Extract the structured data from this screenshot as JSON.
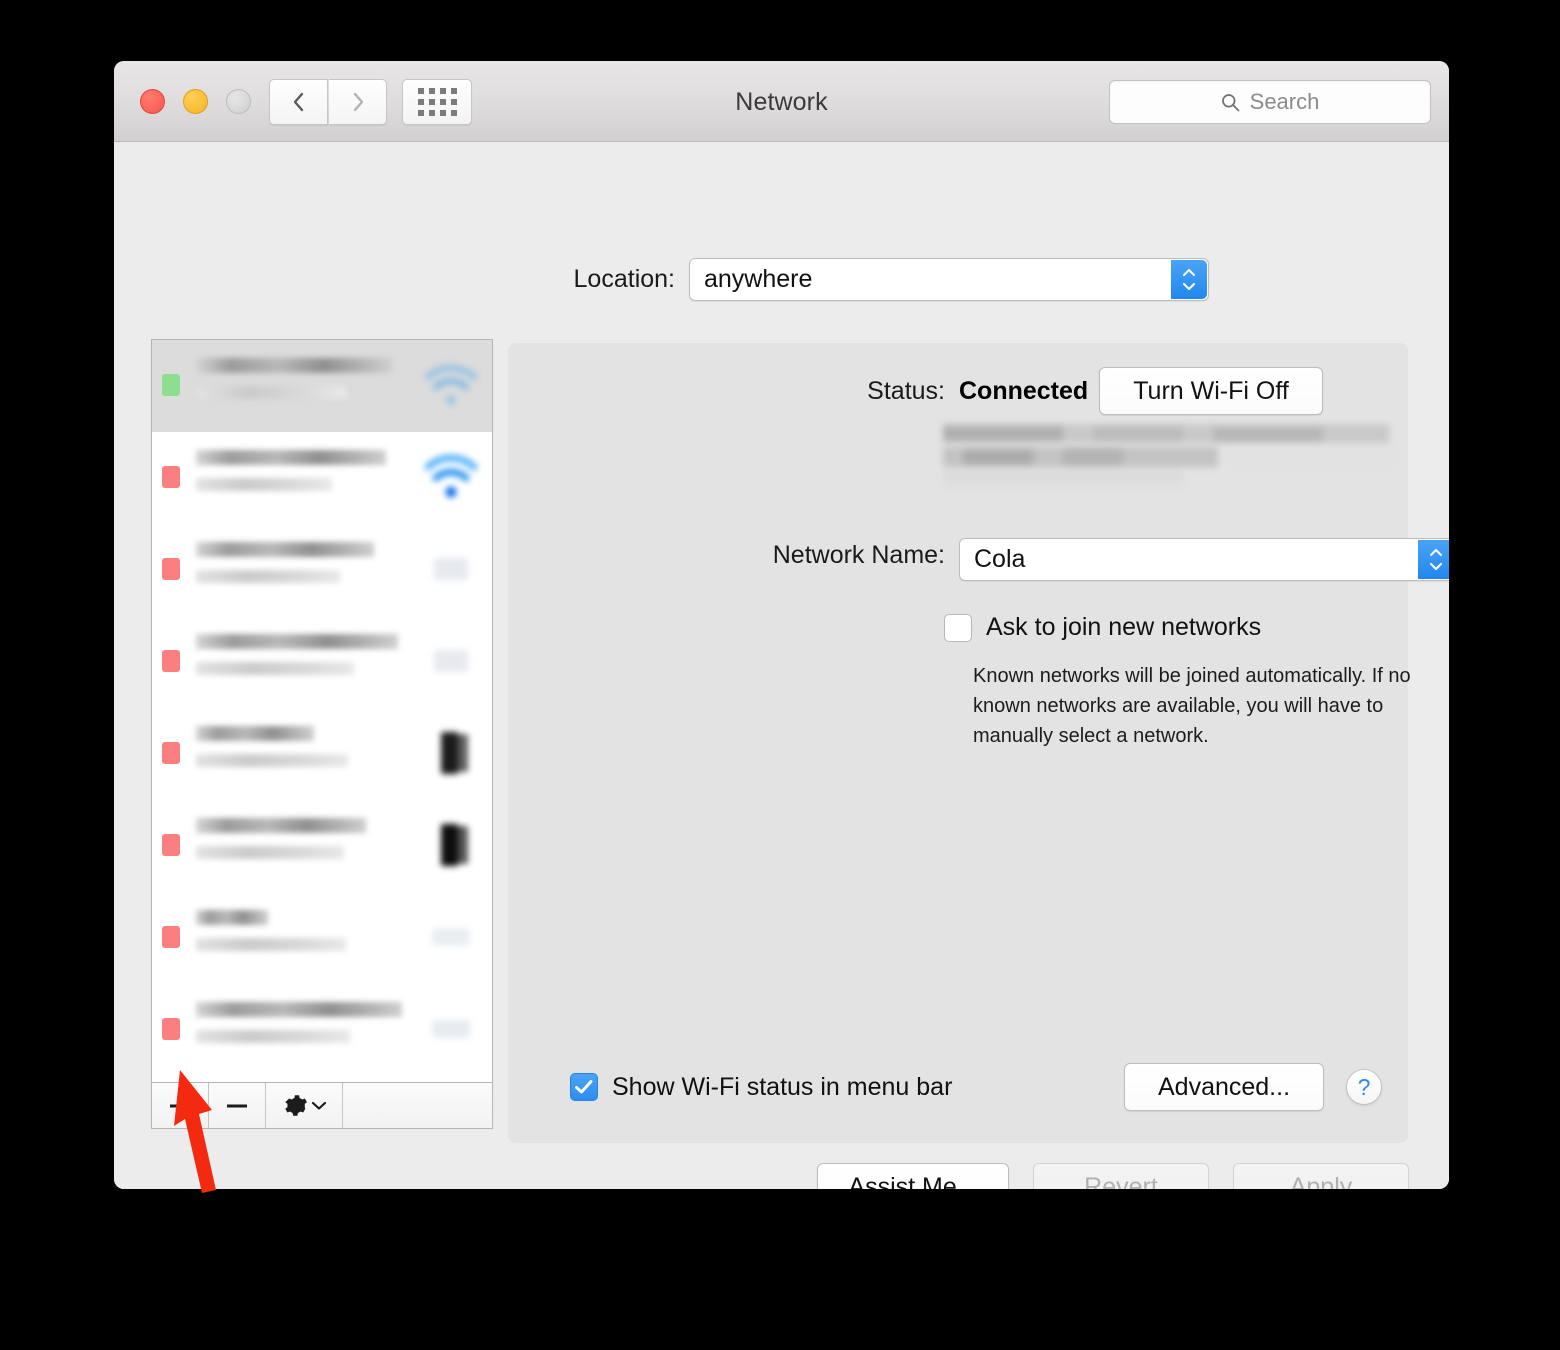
{
  "window": {
    "title": "Network",
    "traffic_lights": [
      "close",
      "minimize",
      "zoom"
    ],
    "nav": {
      "back": "back-arrow",
      "forward": "forward-arrow",
      "grid": "show-all-grid"
    },
    "search": {
      "placeholder": "Search",
      "icon": "search-icon",
      "value": ""
    }
  },
  "location": {
    "label": "Location:",
    "value": "anywhere",
    "options": [
      "anywhere"
    ]
  },
  "sidebar": {
    "services": [
      {
        "status_color": "#8ede8f",
        "name_redacted": true,
        "selected": true,
        "icon": "wifi-icon"
      },
      {
        "status_color": "#fb7f7f",
        "name_redacted": true,
        "selected": false,
        "icon": "wifi-icon"
      },
      {
        "status_color": "#fb7f7f",
        "name_redacted": true,
        "selected": false,
        "icon": "network-icon"
      },
      {
        "status_color": "#fb7f7f",
        "name_redacted": true,
        "selected": false,
        "icon": "network-icon"
      },
      {
        "status_color": "#fb7f7f",
        "name_redacted": true,
        "selected": false,
        "icon": "port-icon"
      },
      {
        "status_color": "#fb7f7f",
        "name_redacted": true,
        "selected": false,
        "icon": "port-icon"
      },
      {
        "status_color": "#fb7f7f",
        "name_redacted": true,
        "selected": false,
        "icon": "network-icon"
      },
      {
        "status_color": "#fb7f7f",
        "name_redacted": true,
        "selected": false,
        "icon": "network-icon"
      },
      {
        "status_color": "#fbd684",
        "name_redacted": true,
        "selected": false,
        "icon": "network-icon"
      }
    ],
    "toolbar": {
      "add_label": "+",
      "remove_label": "−",
      "gear_label": "gear-icon",
      "gear_chevron": "chevron-down-icon"
    }
  },
  "detail": {
    "status_label": "Status:",
    "status_value": "Connected",
    "turn_wifi_off_label": "Turn Wi-Fi Off",
    "status_description_redacted": true,
    "network_name_label": "Network Name:",
    "network_name_value": "Cola",
    "network_name_options": [
      "Cola"
    ],
    "ask_to_join": {
      "label": "Ask to join new networks",
      "checked": false
    },
    "ask_to_join_help": "Known networks will be joined automatically. If no known networks are available, you will have to manually select a network.",
    "show_status_menu_bar": {
      "label": "Show Wi-Fi status in menu bar",
      "checked": true
    },
    "advanced_label": "Advanced...",
    "help_label": "?"
  },
  "footer": {
    "assist_me_label": "Assist Me...",
    "revert_label": "Revert",
    "revert_disabled": true,
    "apply_label": "Apply",
    "apply_disabled": true
  },
  "annotation": {
    "arrow_color": "#f42a10",
    "points_to": "add-service-button"
  },
  "colors": {
    "accent_blue": "#2d8cf0",
    "window_bg": "#ececec",
    "panel_bg": "#e3e3e3",
    "desktop_bg": "#000000",
    "status_green": "#8ede8f",
    "status_red": "#fb7f7f",
    "status_yellow": "#fbd684"
  }
}
